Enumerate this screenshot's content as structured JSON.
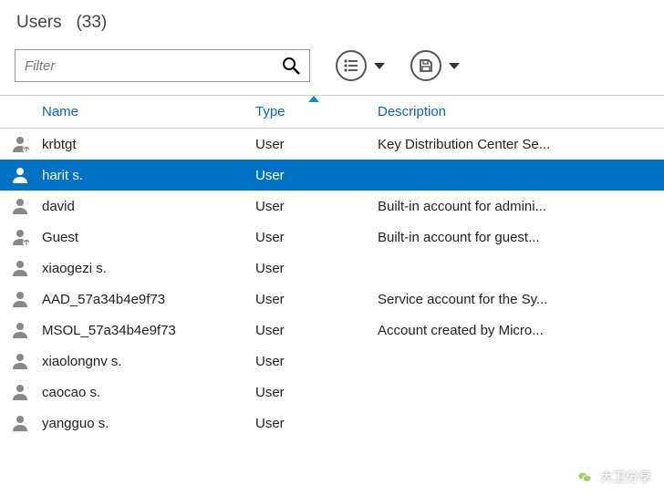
{
  "header": {
    "title": "Users",
    "count": "(33)"
  },
  "filter": {
    "placeholder": "Filter"
  },
  "columns": {
    "name": "Name",
    "type": "Type",
    "description": "Description"
  },
  "rows": [
    {
      "icon": "user-badge",
      "name": "krbtgt",
      "type": "User",
      "description": "Key Distribution Center Se...",
      "selected": false
    },
    {
      "icon": "user",
      "name": "harit s.",
      "type": "User",
      "description": "",
      "selected": true
    },
    {
      "icon": "user",
      "name": "david",
      "type": "User",
      "description": "Built-in account for admini...",
      "selected": false
    },
    {
      "icon": "user-badge",
      "name": "Guest",
      "type": "User",
      "description": "Built-in account for guest...",
      "selected": false
    },
    {
      "icon": "user",
      "name": "xiaogezi s.",
      "type": "User",
      "description": "",
      "selected": false
    },
    {
      "icon": "user",
      "name": "AAD_57a34b4e9f73",
      "type": "User",
      "description": "Service account for the Sy...",
      "selected": false
    },
    {
      "icon": "user",
      "name": "MSOL_57a34b4e9f73",
      "type": "User",
      "description": "Account created by Micro...",
      "selected": false
    },
    {
      "icon": "user",
      "name": "xiaolongnv s.",
      "type": "User",
      "description": "",
      "selected": false
    },
    {
      "icon": "user",
      "name": "caocao s.",
      "type": "User",
      "description": "",
      "selected": false
    },
    {
      "icon": "user",
      "name": "yangguo s.",
      "type": "User",
      "description": "",
      "selected": false
    }
  ],
  "watermark": {
    "text": "大卫分享"
  }
}
